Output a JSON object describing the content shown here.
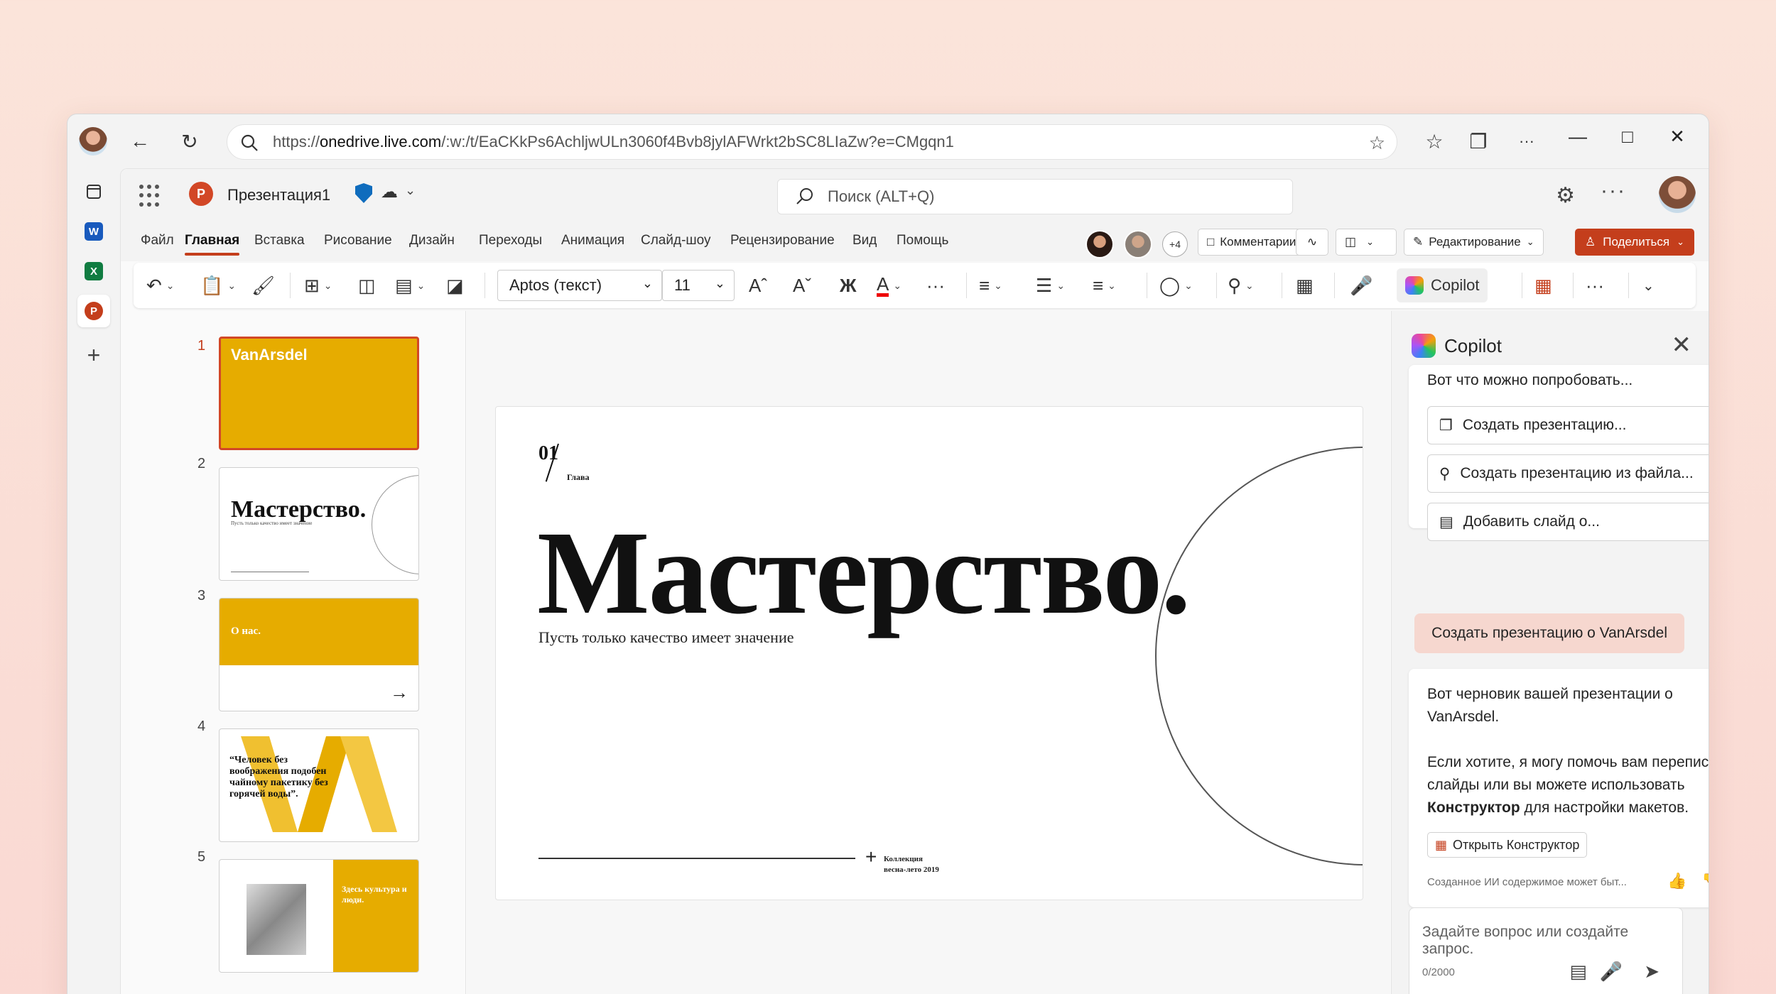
{
  "browser": {
    "url_prefix": "https://",
    "url_host": "onedrive.live.com",
    "url_path": "/:w:/t/EaCKkPs6AchljwULn3060f4Bvb8jylAFWrkt2bSC8LIaZw?e=CMgqn1"
  },
  "app": {
    "doc_title": "Презентация1",
    "search_placeholder": "Поиск (ALT+Q)",
    "rail_apps": [
      "word",
      "excel",
      "powerpoint"
    ]
  },
  "tabs": [
    "Файл",
    "Главная",
    "Вставка",
    "Рисование",
    "Дизайн",
    "Переходы",
    "Анимация",
    "Слайд-шоу",
    "Рецензирование",
    "Вид",
    "Помощь"
  ],
  "active_tab": "Главная",
  "collab": {
    "extra_count": "+4",
    "comments_label": "Комментарии",
    "editing_label": "Редактирование",
    "share_label": "Поделиться"
  },
  "ribbon": {
    "font_name": "Aptos (текст)",
    "font_size": "11",
    "bold_glyph": "Ж",
    "copilot_label": "Copilot"
  },
  "thumbnails": [
    {
      "num": "1",
      "title": "VanArsdel"
    },
    {
      "num": "2",
      "title": "Мастерство.",
      "sub": "Пусть только качество имеет значение"
    },
    {
      "num": "3",
      "title": "О нас."
    },
    {
      "num": "4",
      "quote": "“Человек без воображения подобен чайному пакетику без горячей воды”."
    },
    {
      "num": "5",
      "title": "Здесь культура и люди."
    }
  ],
  "slide": {
    "number": "01",
    "chapter": "Глава",
    "title": "Мастерство.",
    "subtitle": "Пусть только качество имеет значение",
    "collection_line1": "Коллекция",
    "collection_line2": "весна-лето 2019"
  },
  "copilot": {
    "title": "Copilot",
    "try_heading": "Вот что можно попробовать...",
    "suggestions": [
      "Создать презентацию...",
      "Создать презентацию из файла...",
      "Добавить слайд о..."
    ],
    "user_message": "Создать презентацию о VanArsdel",
    "reply_line1": "Вот черновик вашей презентации о VanArsdel.",
    "reply_line2a": "Если хотите, я могу помочь вам переписать слайды или вы можете использовать ",
    "reply_bold": "Конструктор",
    "reply_line2b": " для настройки макетов.",
    "open_designer": "Открыть Конструктор",
    "ai_note": "Созданное ИИ содержимое может быт...",
    "input_placeholder": "Задайте вопрос или создайте запрос.",
    "char_count": "0/2000"
  },
  "colors": {
    "accent": "#c43e1c",
    "slide_yellow": "#e6ac00",
    "user_bubble": "#f6d7cf"
  }
}
